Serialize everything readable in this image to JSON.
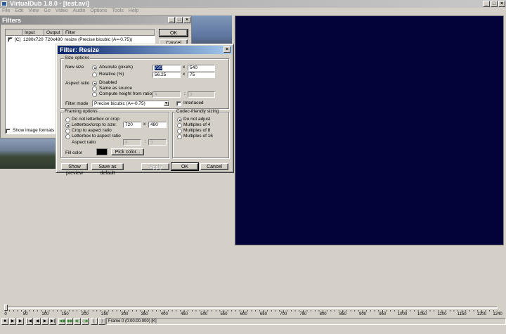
{
  "app": {
    "title": "VirtualDub 1.8.0 - [test.avi]"
  },
  "menu": [
    "File",
    "Edit",
    "View",
    "Go",
    "Video",
    "Audio",
    "Options",
    "Tools",
    "Help"
  ],
  "filters": {
    "title": "Filters",
    "columns": [
      "Input",
      "Output",
      "Filter"
    ],
    "row": {
      "check": "✓",
      "flag": "[C]",
      "input": "1280x720",
      "output": "720x480",
      "filter": "resize (Precise bicubic (A=-0.75))"
    },
    "ok": "OK",
    "cancel": "Cancel",
    "show_image_formats": "Show image formats"
  },
  "resize": {
    "title": "Filter: Resize",
    "size_options": "Size options",
    "new_size": "New size",
    "absolute": "Absolute (pixels)",
    "relative": "Relative (%)",
    "abs_w": "720",
    "abs_h": "540",
    "rel_w": "56.25",
    "rel_h": "75",
    "x": "x",
    "aspect_ratio": "Aspect ratio",
    "disabled": "Disabled",
    "same_as_source": "Same as source",
    "compute_height": "Compute height from ratio:",
    "ratio_a": "4",
    "ratio_b": "3",
    "colon": ":",
    "filter_mode": "Filter mode",
    "filter_mode_value": "Precise bicubic (A=-0.75)",
    "interlaced": "Interlaced",
    "framing_options": "Framing options",
    "no_letterbox": "Do not letterbox or crop",
    "letterbox_crop_size": "Letterbox/crop to size:",
    "frame_w": "720",
    "frame_h": "480",
    "crop_aspect": "Crop to aspect ratio",
    "letterbox_aspect": "Letterbox to aspect ratio",
    "aspect_ratio2": "Aspect ratio",
    "ar_a": "4",
    "ar_b": "3",
    "fill_color": "Fill color",
    "pick_color": "Pick color...",
    "codec_sizing": "Codec-friendly sizing",
    "do_not_adjust": "Do not adjust",
    "mult4": "Multiples of 4",
    "mult8": "Multiples of 8",
    "mult16": "Multiples of 16",
    "show_preview": "Show preview",
    "save_default": "Save as default",
    "apply": "Apply",
    "ok": "OK",
    "cancel": "Cancel"
  },
  "timeline": {
    "ticks": [
      "0",
      "50",
      "100",
      "150",
      "200",
      "250",
      "300",
      "350",
      "400",
      "450",
      "500",
      "550",
      "600",
      "650",
      "700",
      "750",
      "800",
      "850",
      "900",
      "950",
      "1000",
      "1050",
      "1100",
      "1150",
      "1200",
      "1240"
    ],
    "max": 1240,
    "frame_status": "Frame 0 (0:00:00.000) [K]"
  },
  "colors": {
    "video_bg": "#03033a",
    "dialog_title": "#0a246a",
    "fill": "#000000"
  }
}
